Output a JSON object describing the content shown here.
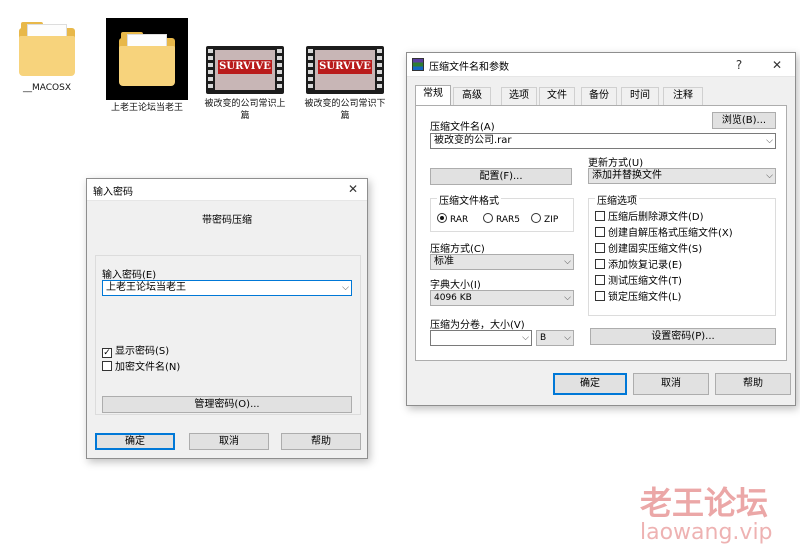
{
  "desktop": {
    "icons": [
      {
        "label": "__MACOSX"
      },
      {
        "label": "上老王论坛当老王"
      },
      {
        "label": "被改变的公司常识上篇",
        "thumb_text": "SURVIVE"
      },
      {
        "label": "被改变的公司常识下篇",
        "thumb_text": "SURVIVE"
      }
    ]
  },
  "password_dialog": {
    "title": "输入密码",
    "close": "✕",
    "heading": "带密码压缩",
    "field_label": "输入密码(E)",
    "password_value": "上老王论坛当老王",
    "show_password": {
      "label": "显示密码(S)",
      "checked": true
    },
    "encrypt_names": {
      "label": "加密文件名(N)",
      "checked": false
    },
    "manage_button": "管理密码(O)...",
    "ok": "确定",
    "cancel": "取消",
    "help": "帮助"
  },
  "archive_dialog": {
    "title": "压缩文件名和参数",
    "help_glyph": "?",
    "close": "✕",
    "tabs": [
      "常规",
      "高级",
      "选项",
      "文件",
      "备份",
      "时间",
      "注释"
    ],
    "active_tab": "常规",
    "archive_name_label": "压缩文件名(A)",
    "browse_button": "浏览(B)...",
    "archive_name_value": "被改变的公司.rar",
    "profiles_button": "配置(F)...",
    "update_mode_label": "更新方式(U)",
    "update_mode_value": "添加并替换文件",
    "format_group": "压缩文件格式",
    "formats": [
      {
        "label": "RAR",
        "selected": true
      },
      {
        "label": "RAR5",
        "selected": false
      },
      {
        "label": "ZIP",
        "selected": false
      }
    ],
    "method_label": "压缩方式(C)",
    "method_value": "标准",
    "dict_label": "字典大小(I)",
    "dict_value": "4096 KB",
    "split_label": "压缩为分卷，大小(V)",
    "split_value": "",
    "split_unit": "B",
    "options_group": "压缩选项",
    "options": [
      {
        "label": "压缩后删除源文件(D)",
        "checked": false
      },
      {
        "label": "创建自解压格式压缩文件(X)",
        "checked": false
      },
      {
        "label": "创建固实压缩文件(S)",
        "checked": false
      },
      {
        "label": "添加恢复记录(E)",
        "checked": false
      },
      {
        "label": "测试压缩文件(T)",
        "checked": false
      },
      {
        "label": "锁定压缩文件(L)",
        "checked": false
      }
    ],
    "set_password_button": "设置密码(P)...",
    "ok": "确定",
    "cancel": "取消",
    "help": "帮助"
  },
  "watermark": {
    "title": "老王论坛",
    "url": "laowang.vip"
  },
  "colors": {
    "accent": "#0078d7",
    "folder": "#f7d37c",
    "watermark": "#e58a8a"
  }
}
